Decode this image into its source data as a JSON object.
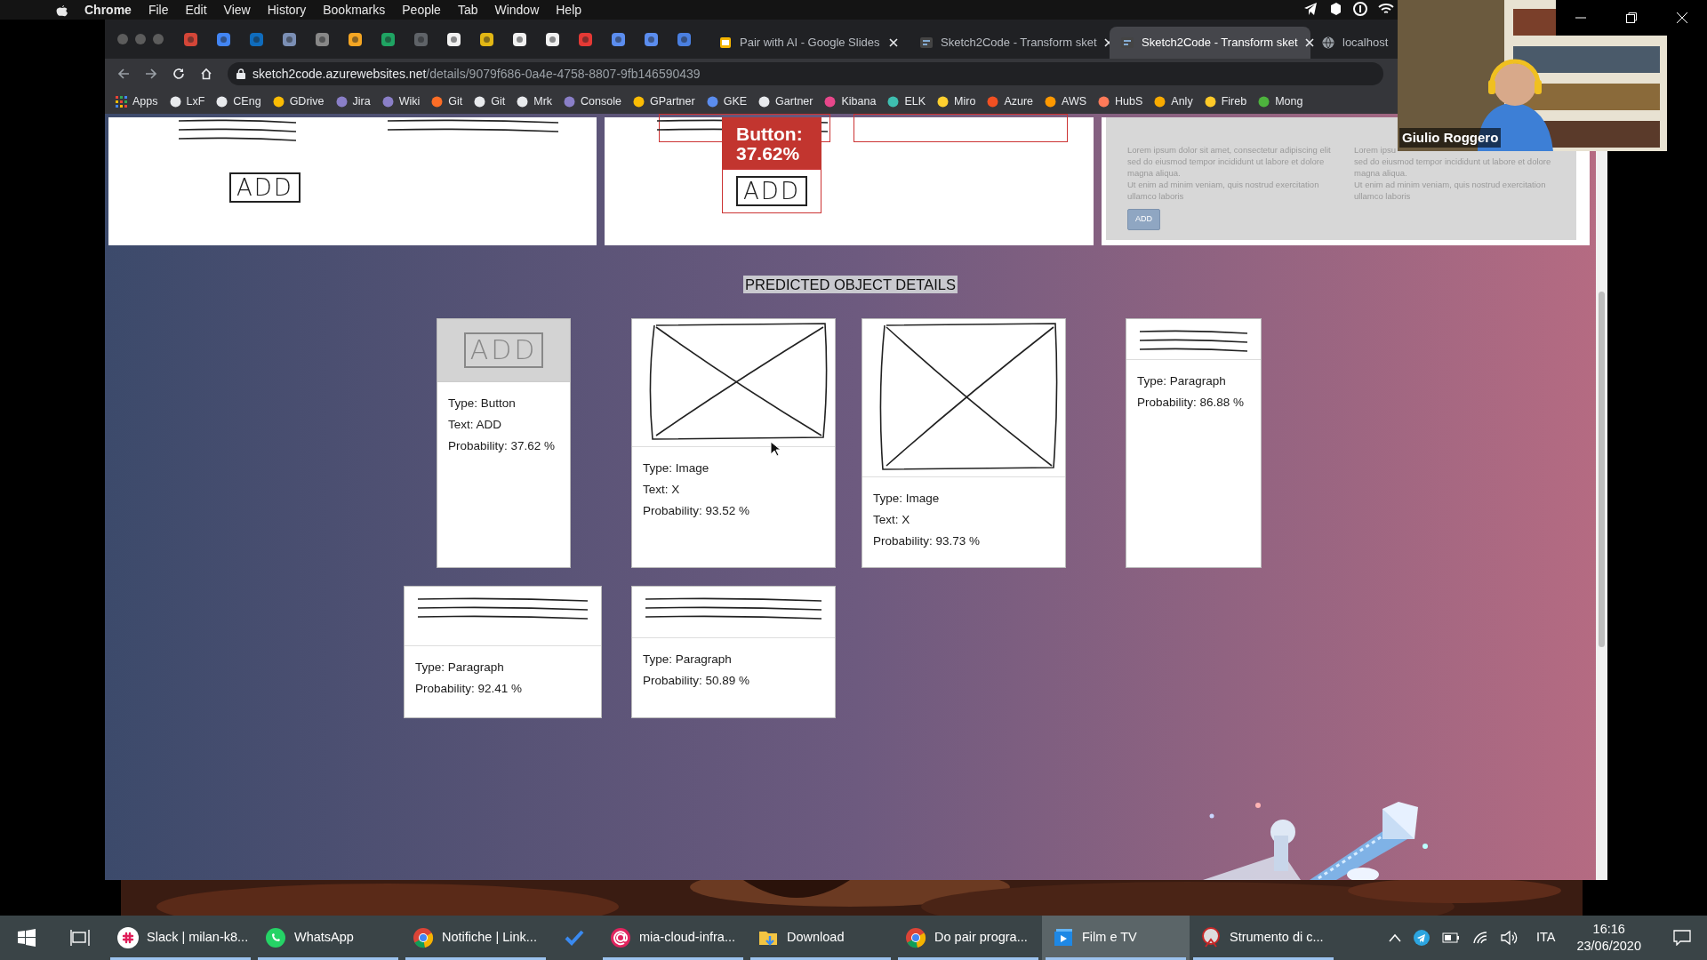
{
  "menu_bar": {
    "app": "Chrome",
    "items": [
      "File",
      "Edit",
      "View",
      "History",
      "Bookmarks",
      "People",
      "Tab",
      "Window",
      "Help"
    ]
  },
  "browser": {
    "tabs": [
      {
        "label": "Pair with AI - Google Slides",
        "selected": false
      },
      {
        "label": "Sketch2Code - Transform sket",
        "selected": false
      },
      {
        "label": "Sketch2Code - Transform sket",
        "selected": true
      },
      {
        "label": "localhost",
        "selected": false
      }
    ],
    "address": {
      "domain": "sketch2code.azurewebsites.net",
      "path": "/details/9079f686-0a4e-4758-8807-9fb146590439"
    },
    "bookmarks": [
      "Apps",
      "LxF",
      "CEng",
      "GDrive",
      "Jira",
      "Wiki",
      "Git",
      "Git",
      "Mrk",
      "Console",
      "GPartner",
      "GKE",
      "Gartner",
      "Kibana",
      "ELK",
      "Miro",
      "Azure",
      "AWS",
      "HubS",
      "Anly",
      "Fireb",
      "Mong"
    ]
  },
  "top_cards": [
    {
      "kind": "sketch",
      "label": "ADD"
    },
    {
      "kind": "annotated",
      "label": "ADD",
      "tag": [
        "Button:",
        "37.62%"
      ]
    },
    {
      "kind": "rendered",
      "columns": [
        [
          "Lorem ipsum dolor sit amet, consectetur adipiscing elit",
          "sed do eiusmod tempor incididunt ut labore et dolore",
          "magna aliqua.",
          "Ut enim ad minim veniam, quis nostrud exercitation",
          "ullamco laboris"
        ],
        [
          "Lorem ipsu",
          "sed do eiusmod tempor incididunt ut labore et dolore",
          "magna aliqua.",
          "Ut enim ad minim veniam, quis nostrud exercitation",
          "ullamco laboris"
        ]
      ],
      "button": "ADD"
    }
  ],
  "section_title": "PREDICTED OBJECT DETAILS",
  "detection_rows": [
    {
      "cards": [
        {
          "kind": "button",
          "label": "ADD",
          "lines": [
            "Type: Button",
            "Text: ADD",
            "Probability: 37.62 %"
          ]
        },
        {
          "lines": [
            "Type: Image",
            "Text: X",
            "Probability: 93.52 %"
          ]
        },
        {
          "lines": [
            "Type: Image",
            "Text: X",
            "Probability: 93.73 %"
          ]
        },
        {
          "kind": "paragraph",
          "lines": [
            "Type: Paragraph",
            "Probability: 86.88 %"
          ]
        }
      ]
    },
    {
      "cards": [
        {
          "kind": "paragraph",
          "lines": [
            "Type: Paragraph",
            "Probability: 92.41 %"
          ]
        },
        {
          "kind": "paragraph",
          "lines": [
            "Type: Paragraph",
            "Probability: 50.89 %"
          ]
        }
      ]
    }
  ],
  "webcam": {
    "name": "Giulio Roggero"
  },
  "taskbar": {
    "items": [
      {
        "kind": "slack",
        "label": "Slack | milan-k8...",
        "selected": false
      },
      {
        "kind": "whatsapp",
        "label": "WhatsApp",
        "selected": false
      },
      {
        "kind": "chrome",
        "label": "Notifiche | Link...",
        "selected": false
      },
      {
        "kind": "todo",
        "selected": false
      },
      {
        "kind": "mail",
        "label": "mia-cloud-infra...",
        "selected": false
      },
      {
        "kind": "folder",
        "label": "Download",
        "selected": false
      },
      {
        "kind": "chrome",
        "label": "Do pair progra...",
        "selected": false
      },
      {
        "kind": "film",
        "label": "Film e TV",
        "selected": true
      },
      {
        "kind": "snip",
        "label": "Strumento di c...",
        "selected": false
      }
    ],
    "language": "ITA",
    "time": "16:16",
    "date": "23/06/2020"
  }
}
